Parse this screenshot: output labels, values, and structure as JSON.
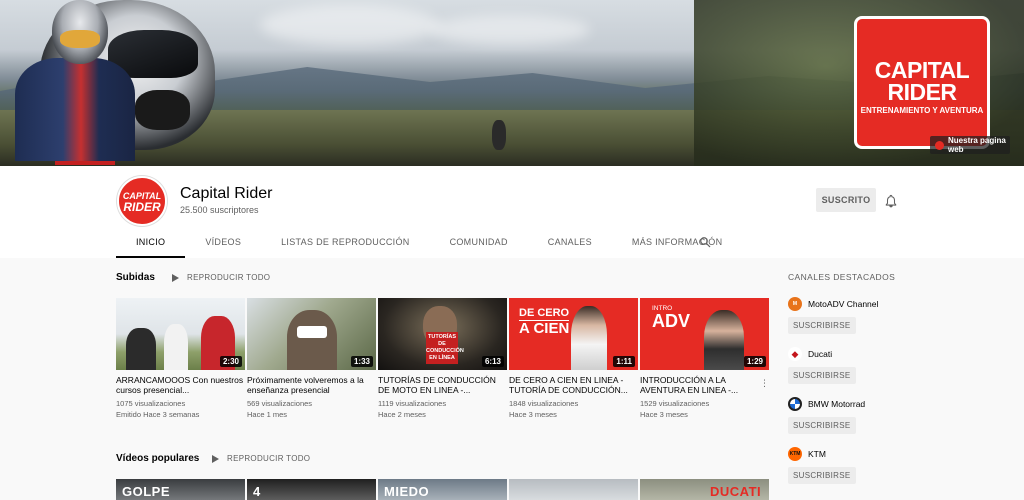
{
  "banner": {
    "logo_line1": "CAPITAL",
    "logo_line2": "RIDER",
    "logo_tagline": "ENTRENAMIENTO Y AVENTURA",
    "web_link": "Nuestra pagina web",
    "accent": "#e52b24"
  },
  "channel": {
    "avatar_line1": "CAPITAL",
    "avatar_line2": "RIDER",
    "name": "Capital Rider",
    "subscribers": "25.500 suscriptores",
    "subscribe_label": "SUSCRITO",
    "bell_icon": "bell-icon"
  },
  "tabs": [
    {
      "label": "INICIO",
      "active": true
    },
    {
      "label": "VÍDEOS"
    },
    {
      "label": "LISTAS DE REPRODUCCIÓN"
    },
    {
      "label": "COMUNIDAD"
    },
    {
      "label": "CANALES"
    },
    {
      "label": "MÁS INFORMACIÓN"
    }
  ],
  "uploads": {
    "title": "Subidas",
    "play_all": "REPRODUCIR TODO",
    "videos": [
      {
        "title": "ARRANCAMOOOS Con nuestros cursos presencial...",
        "views": "1075 visualizaciones",
        "date": "Emitido Hace 3 semanas",
        "duration": "2:30"
      },
      {
        "title": "Próximamente volveremos a la enseñanza presencial",
        "views": "569 visualizaciones",
        "date": "Hace 1 mes",
        "duration": "1:33"
      },
      {
        "title": "TUTORÍAS DE CONDUCCIÓN DE MOTO EN LINEA -...",
        "views": "1119 visualizaciones",
        "date": "Hace 2 meses",
        "duration": "6:13",
        "thumb_text": "TUTORÍAS DE CONDUCCIÓN EN LÍNEA"
      },
      {
        "title": "DE CERO A CIEN EN LINEA - TUTORÍA DE CONDUCCIÓN...",
        "views": "1848 visualizaciones",
        "date": "Hace 3 meses",
        "duration": "1:11",
        "thumb_text1": "DE CERO",
        "thumb_text2": "A CIEN"
      },
      {
        "title": "INTRODUCCIÓN A LA AVENTURA EN LINEA -...",
        "views": "1529 visualizaciones",
        "date": "Hace 3 meses",
        "duration": "1:29",
        "thumb_text1": "INTRO",
        "thumb_text2": "ADV"
      }
    ]
  },
  "popular": {
    "title": "Vídeos populares",
    "play_all": "REPRODUCIR TODO",
    "thumb_texts": [
      "GOLPE",
      "4",
      "MIEDO",
      "",
      "DUCATI"
    ]
  },
  "sidebar": {
    "title": "CANALES DESTACADOS",
    "channels": [
      {
        "name": "MotoADV Channel",
        "button": "SUSCRIBIRSE",
        "icon_color": "#e8731a",
        "icon": "motoadv-logo-icon"
      },
      {
        "name": "Ducati",
        "button": "SUSCRIBIRSE",
        "icon_color": "#ffffff",
        "icon": "ducati-logo-icon"
      },
      {
        "name": "BMW Motorrad",
        "button": "SUSCRIBIRSE",
        "icon_color": "#1c69d4",
        "icon": "bmw-logo-icon"
      },
      {
        "name": "KTM",
        "button": "SUSCRIBIRSE",
        "icon_color": "#ff6600",
        "icon": "ktm-logo-icon"
      }
    ]
  }
}
